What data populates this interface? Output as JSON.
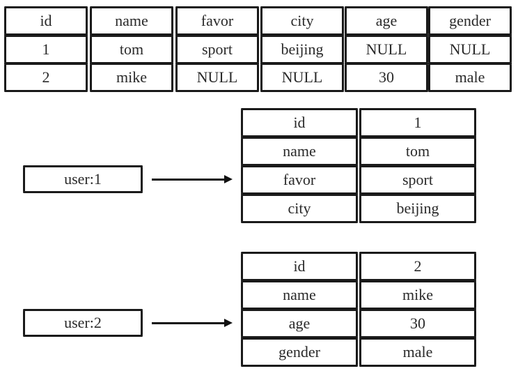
{
  "relational_table": {
    "headers": [
      "id",
      "name",
      "favor",
      "city",
      "age",
      "gender"
    ],
    "rows": [
      [
        "1",
        "tom",
        "sport",
        "beijing",
        "NULL",
        "NULL"
      ],
      [
        "2",
        "mike",
        "NULL",
        "NULL",
        "30",
        "male"
      ]
    ]
  },
  "hashes": [
    {
      "key": "user:1",
      "fields": [
        [
          "id",
          "1"
        ],
        [
          "name",
          "tom"
        ],
        [
          "favor",
          "sport"
        ],
        [
          "city",
          "beijing"
        ]
      ]
    },
    {
      "key": "user:2",
      "fields": [
        [
          "id",
          "2"
        ],
        [
          "name",
          "mike"
        ],
        [
          "age",
          "30"
        ],
        [
          "gender",
          "male"
        ]
      ]
    }
  ]
}
